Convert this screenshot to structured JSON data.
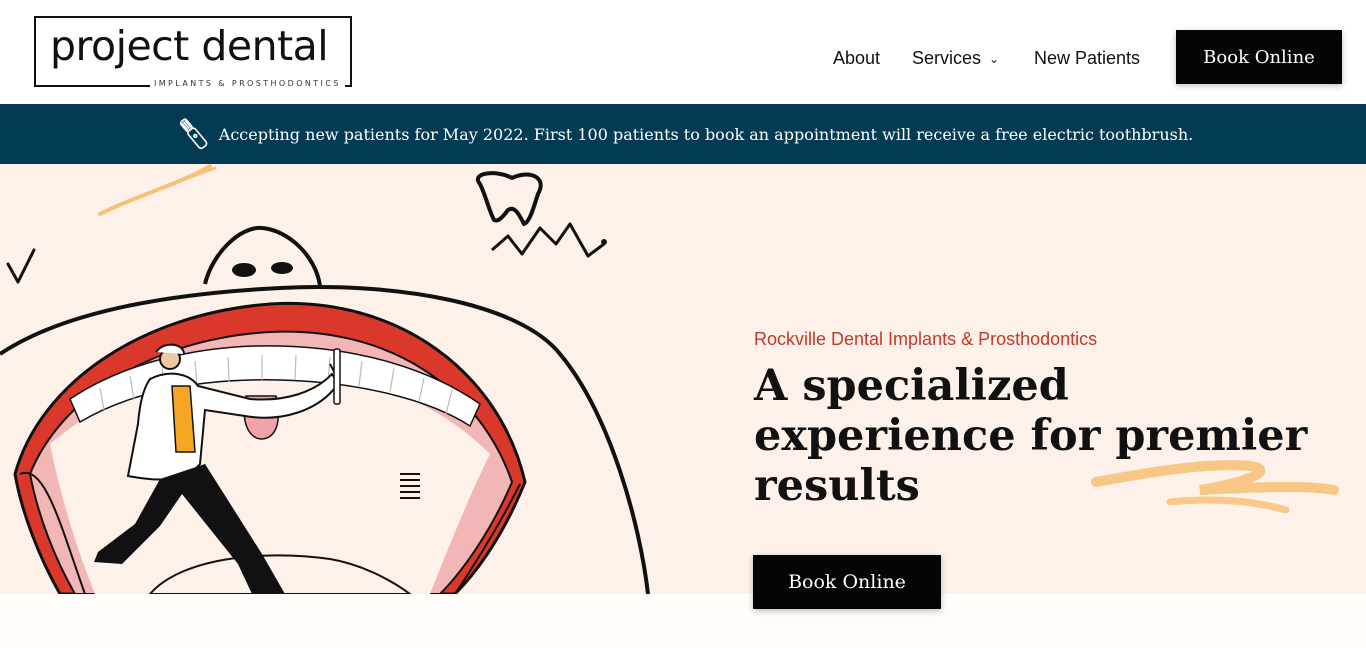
{
  "header": {
    "logo": {
      "wordmark": "project dental",
      "tagline": "IMPLANTS & PROSTHODONTICS"
    },
    "nav": [
      {
        "label": "About"
      },
      {
        "label": "Services",
        "icon": "chevron-down-icon"
      },
      {
        "label": "New Patients"
      }
    ],
    "cta_label": "Book Online"
  },
  "announcement": {
    "icon": "electric-toothbrush-icon",
    "text": "Accepting new patients for May 2022. First 100 patients to book an appointment will receive a free electric toothbrush."
  },
  "hero": {
    "eyebrow": "Rockville Dental Implants & Prosthodontics",
    "headline": "A specialized experience for premier results",
    "cta_label": "Book Online",
    "illustration": "dentist-in-mouth-illustration"
  },
  "colors": {
    "announcement_bg": "#033b55",
    "hero_bg": "#fdf1e9",
    "eyebrow": "#c0392b",
    "button_bg": "#050505",
    "accent_scribble": "#f6c27a",
    "lips_red": "#d9382a"
  }
}
